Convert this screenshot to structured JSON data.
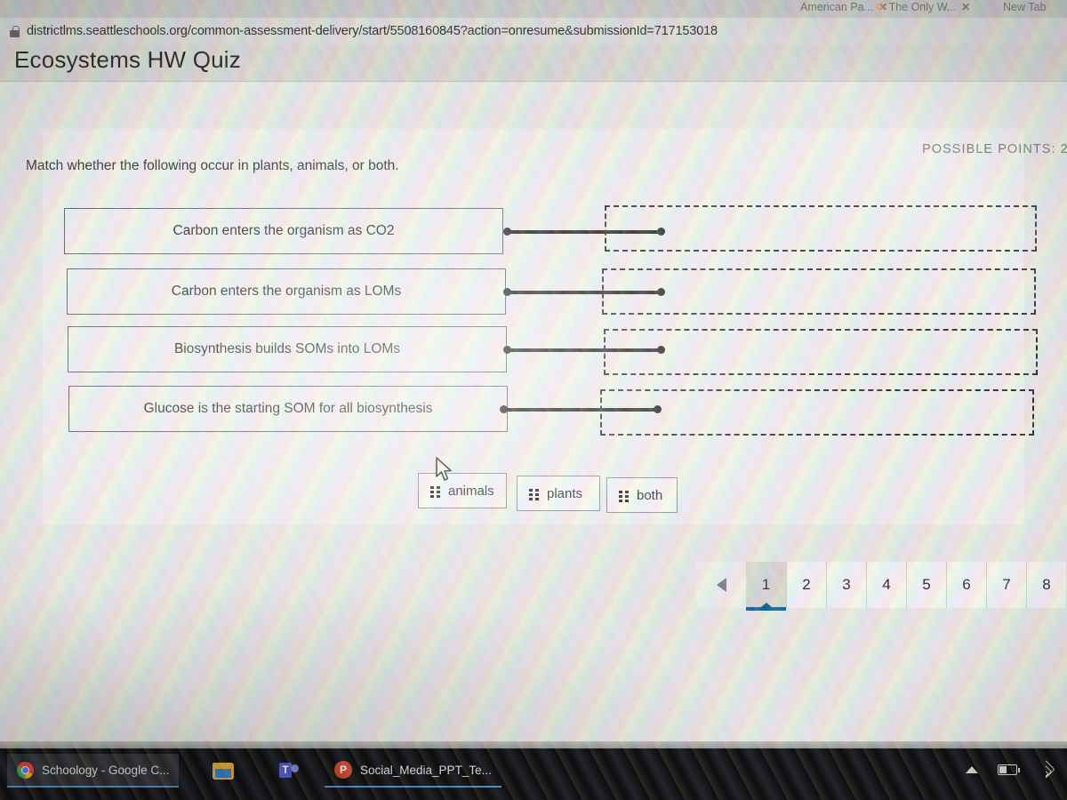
{
  "browser": {
    "tabs": [
      {
        "title": "American Pa...",
        "close_label": "✕"
      },
      {
        "title": "The Only W...",
        "close_label": "✕",
        "favicon": "google-g-icon"
      },
      {
        "title": "New Tab",
        "close_label": ""
      }
    ],
    "url": "districtlms.seattleschools.org/common-assessment-delivery/start/5508160845?action=onresume&submissionId=717153018",
    "lock_icon": "lock-icon"
  },
  "page": {
    "title": "Ecosystems HW Quiz",
    "possible_points": "POSSIBLE POINTS: 2",
    "prompt": "Match whether the following occur in plants, animals, or both."
  },
  "question": {
    "items": [
      {
        "text": "Carbon enters the organism as CO2",
        "dropzone_value": ""
      },
      {
        "text": "Carbon enters the organism as LOMs",
        "dropzone_value": ""
      },
      {
        "text": "Biosynthesis builds SOMs into LOMs",
        "dropzone_value": ""
      },
      {
        "text": "Glucose is the starting SOM for all biosynthesis",
        "dropzone_value": ""
      }
    ],
    "choices": [
      {
        "label": "animals",
        "handle_icon": "drag-handle-icon"
      },
      {
        "label": "plants",
        "handle_icon": "drag-handle-icon"
      },
      {
        "label": "both",
        "handle_icon": "drag-handle-icon"
      }
    ]
  },
  "pagination": {
    "prev_icon": "triangle-left-icon",
    "pages": [
      "1",
      "2",
      "3",
      "4",
      "5",
      "6",
      "7",
      "8"
    ],
    "current": "1",
    "accent_color": "#1264a3"
  },
  "taskbar": {
    "items": [
      {
        "label": "Schoology - Google C...",
        "icon": "chrome-icon",
        "state": "active"
      },
      {
        "label": "",
        "icon": "file-explorer-icon",
        "state": "pinned"
      },
      {
        "label": "",
        "icon": "microsoft-teams-icon",
        "state": "pinned"
      },
      {
        "label": "Social_Media_PPT_Te...",
        "icon": "powerpoint-icon",
        "state": "open"
      }
    ],
    "tray": [
      {
        "icon": "chevron-up-icon"
      },
      {
        "icon": "battery-icon"
      },
      {
        "icon": "wifi-icon"
      }
    ]
  }
}
